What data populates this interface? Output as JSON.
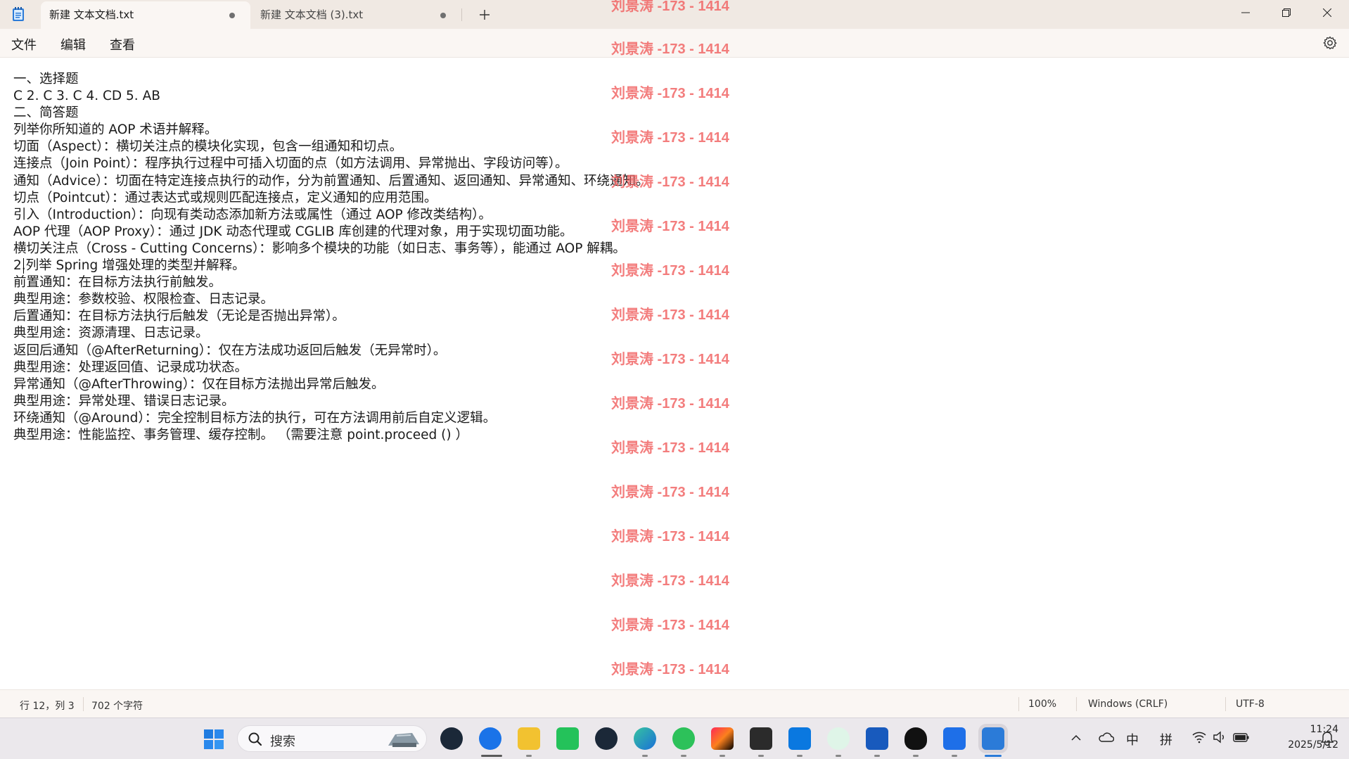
{
  "tabs": [
    {
      "label": "新建 文本文档.txt",
      "active": true
    },
    {
      "label": "新建 文本文档 (3).txt",
      "active": false
    }
  ],
  "menu": {
    "file": "文件",
    "edit": "编辑",
    "view": "查看"
  },
  "editor": {
    "lines": [
      "一、选择题",
      "C 2. C 3. C 4. CD 5. AB",
      "二、简答题",
      "列举你所知道的 AOP 术语并解释。",
      "切面（Aspect）：横切关注点的模块化实现，包含一组通知和切点。",
      "连接点（Join Point）：程序执行过程中可插入切面的点（如方法调用、异常抛出、字段访问等）。",
      "通知（Advice）：切面在特定连接点执行的动作，分为前置通知、后置通知、返回通知、异常通知、环绕通知。",
      "切点（Pointcut）：通过表达式或规则匹配连接点，定义通知的应用范围。",
      "引入（Introduction）：向现有类动态添加新方法或属性（通过 AOP 修改类结构）。",
      "AOP 代理（AOP Proxy）：通过 JDK 动态代理或 CGLIB 库创建的代理对象，用于实现切面功能。",
      "横切关注点（Cross - Cutting Concerns）：影响多个模块的功能（如日志、事务等），能通过 AOP 解耦。",
      "2.列举 Spring 增强处理的类型并解释。",
      "前置通知：在目标方法执行前触发。",
      "典型用途：参数校验、权限检查、日志记录。",
      "后置通知：在目标方法执行后触发（无论是否抛出异常）。",
      "典型用途：资源清理、日志记录。",
      "返回后通知（@AfterReturning）：仅在方法成功返回后触发（无异常时）。",
      "典型用途：处理返回值、记录成功状态。",
      "异常通知（@AfterThrowing）：仅在目标方法抛出异常后触发。",
      "典型用途：异常处理、错误日志记录。",
      "环绕通知（@Around）：完全控制目标方法的执行，可在方法调用前后自定义逻辑。",
      "典型用途：性能监控、事务管理、缓存控制。 （需要注意 point.proceed () ）"
    ]
  },
  "watermark": "刘景涛 -173 - 1414",
  "status": {
    "position": "行 12，列 3",
    "chars": "702 个字符",
    "zoom": "100%",
    "line_ending": "Windows (CRLF)",
    "encoding": "UTF-8"
  },
  "taskbar": {
    "search_label": "搜索",
    "tray": {
      "ime_mode": "中",
      "ime": "拼"
    },
    "time": "11:24",
    "date": "2025/5/12"
  },
  "colors": {
    "watermark": "#f06060",
    "titlebar": "#f0e9e3",
    "taskbar": "#ebe8ec"
  }
}
